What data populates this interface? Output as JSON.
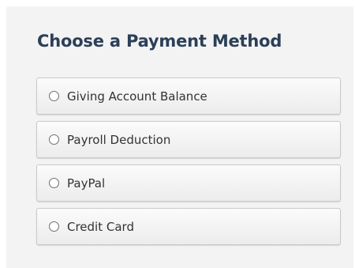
{
  "payment": {
    "title": "Choose a Payment Method",
    "options": [
      {
        "label": "Giving Account Balance"
      },
      {
        "label": "Payroll Deduction"
      },
      {
        "label": "PayPal"
      },
      {
        "label": "Credit Card"
      }
    ]
  },
  "colors": {
    "title": "#2b3f57",
    "panel_background": "#f3f3f3",
    "option_border": "#c9c9c9"
  }
}
